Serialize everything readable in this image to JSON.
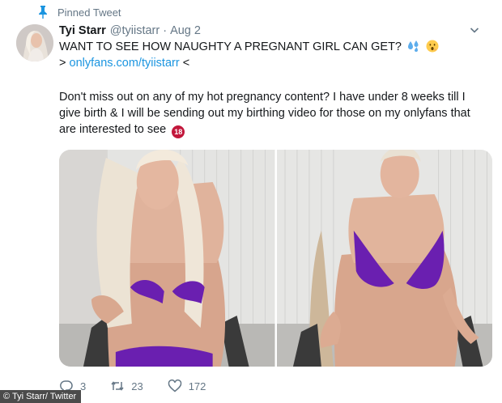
{
  "pinned": {
    "label": "Pinned Tweet",
    "icon": "pin-icon"
  },
  "tweet": {
    "name": "Tyi Starr",
    "handle": "@tyiistarr",
    "separator": "·",
    "time": "Aug 2",
    "line1": "WANT TO SEE HOW NAUGHTY A PREGNANT GIRL CAN GET?",
    "link_prefix": ">",
    "link": "onlyfans.com/tyiistarr",
    "link_suffix": "<",
    "line3": "Don't miss out on any of my hot pregnancy content? I have under 8 weeks till I",
    "line4": "give birth & I will be sending out my birthing video for those on my onlyfans that",
    "line5": "are interested to see",
    "badge": "18"
  },
  "actions": {
    "replies": "3",
    "retweets": "23",
    "likes": "172"
  },
  "credit": "© Tyi Starr/ Twitter",
  "colors": {
    "link": "#1b95e0",
    "muted": "#657786",
    "bikini": "#6a1fb0",
    "badge": "#c2173b"
  }
}
